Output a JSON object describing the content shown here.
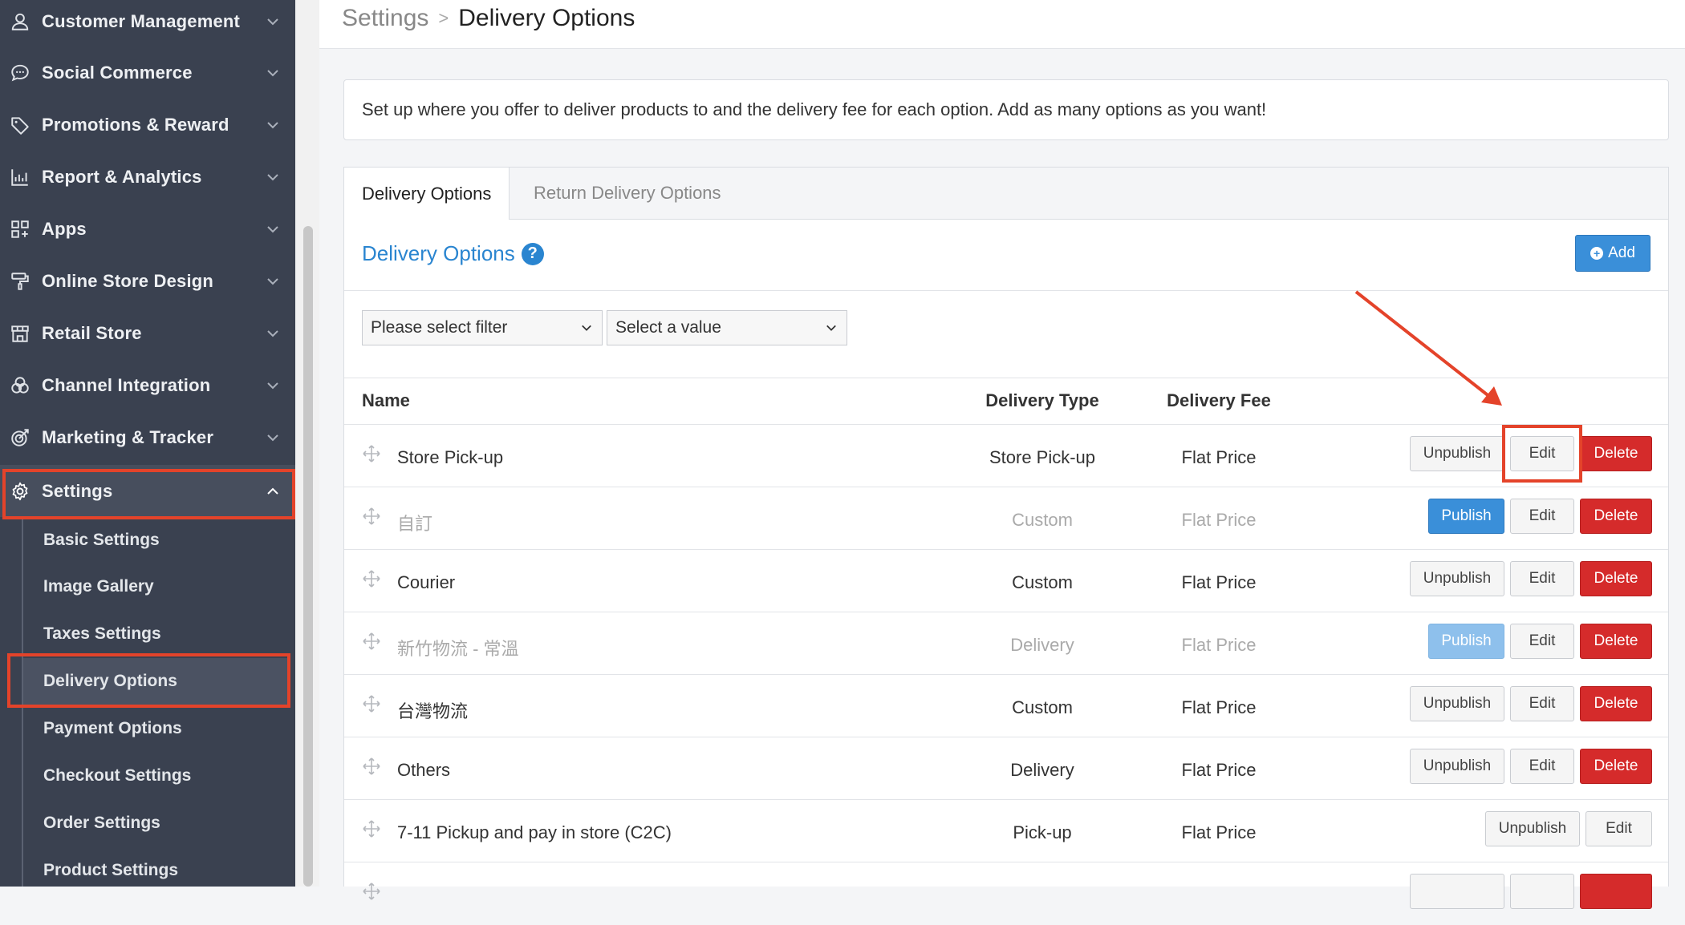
{
  "sidebar": {
    "items": [
      {
        "label": "Customer Management",
        "icon": "user-icon"
      },
      {
        "label": "Social Commerce",
        "icon": "chat-icon"
      },
      {
        "label": "Promotions & Reward",
        "icon": "tag-icon"
      },
      {
        "label": "Report & Analytics",
        "icon": "chart-icon"
      },
      {
        "label": "Apps",
        "icon": "apps-icon"
      },
      {
        "label": "Online Store Design",
        "icon": "paint-roller-icon"
      },
      {
        "label": "Retail Store",
        "icon": "store-icon"
      },
      {
        "label": "Channel Integration",
        "icon": "channels-icon"
      },
      {
        "label": "Marketing & Tracker",
        "icon": "target-icon"
      },
      {
        "label": "Settings",
        "icon": "gear-icon"
      }
    ],
    "sub_items": [
      {
        "label": "Basic Settings"
      },
      {
        "label": "Image Gallery"
      },
      {
        "label": "Taxes Settings"
      },
      {
        "label": "Delivery Options"
      },
      {
        "label": "Payment Options"
      },
      {
        "label": "Checkout Settings"
      },
      {
        "label": "Order Settings"
      },
      {
        "label": "Product Settings"
      }
    ]
  },
  "breadcrumb": {
    "parent": "Settings",
    "separator": ">",
    "current": "Delivery Options"
  },
  "info_text": "Set up where you offer to deliver products to and the delivery fee for each option. Add as many options as you want!",
  "tabs": [
    {
      "label": "Delivery Options"
    },
    {
      "label": "Return Delivery Options"
    }
  ],
  "section": {
    "title": "Delivery Options",
    "help": "?",
    "add_label": "Add"
  },
  "filters": {
    "filter_placeholder": "Please select filter",
    "value_placeholder": "Select a value"
  },
  "table": {
    "headers": {
      "name": "Name",
      "type": "Delivery Type",
      "fee": "Delivery Fee"
    },
    "rows": [
      {
        "name": "Store Pick-up",
        "type": "Store Pick-up",
        "fee": "Flat Price",
        "toggle": "Unpublish",
        "edit": "Edit",
        "delete": "Delete"
      },
      {
        "name": "自訂",
        "type": "Custom",
        "fee": "Flat Price",
        "toggle": "Publish",
        "edit": "Edit",
        "delete": "Delete"
      },
      {
        "name": "Courier",
        "type": "Custom",
        "fee": "Flat Price",
        "toggle": "Unpublish",
        "edit": "Edit",
        "delete": "Delete"
      },
      {
        "name": "新竹物流 - 常溫",
        "type": "Delivery",
        "fee": "Flat Price",
        "toggle": "Publish",
        "edit": "Edit",
        "delete": "Delete"
      },
      {
        "name": "台灣物流",
        "type": "Custom",
        "fee": "Flat Price",
        "toggle": "Unpublish",
        "edit": "Edit",
        "delete": "Delete"
      },
      {
        "name": "Others",
        "type": "Delivery",
        "fee": "Flat Price",
        "toggle": "Unpublish",
        "edit": "Edit",
        "delete": "Delete"
      },
      {
        "name": "7-11 Pickup and pay in store (C2C)",
        "type": "Pick-up",
        "fee": "Flat Price",
        "toggle": "Unpublish",
        "edit": "Edit"
      }
    ]
  },
  "colors": {
    "accent": "#2a85d0",
    "danger": "#d52b2b",
    "annotation": "#e4432a",
    "sidebar": "#3a4150"
  }
}
